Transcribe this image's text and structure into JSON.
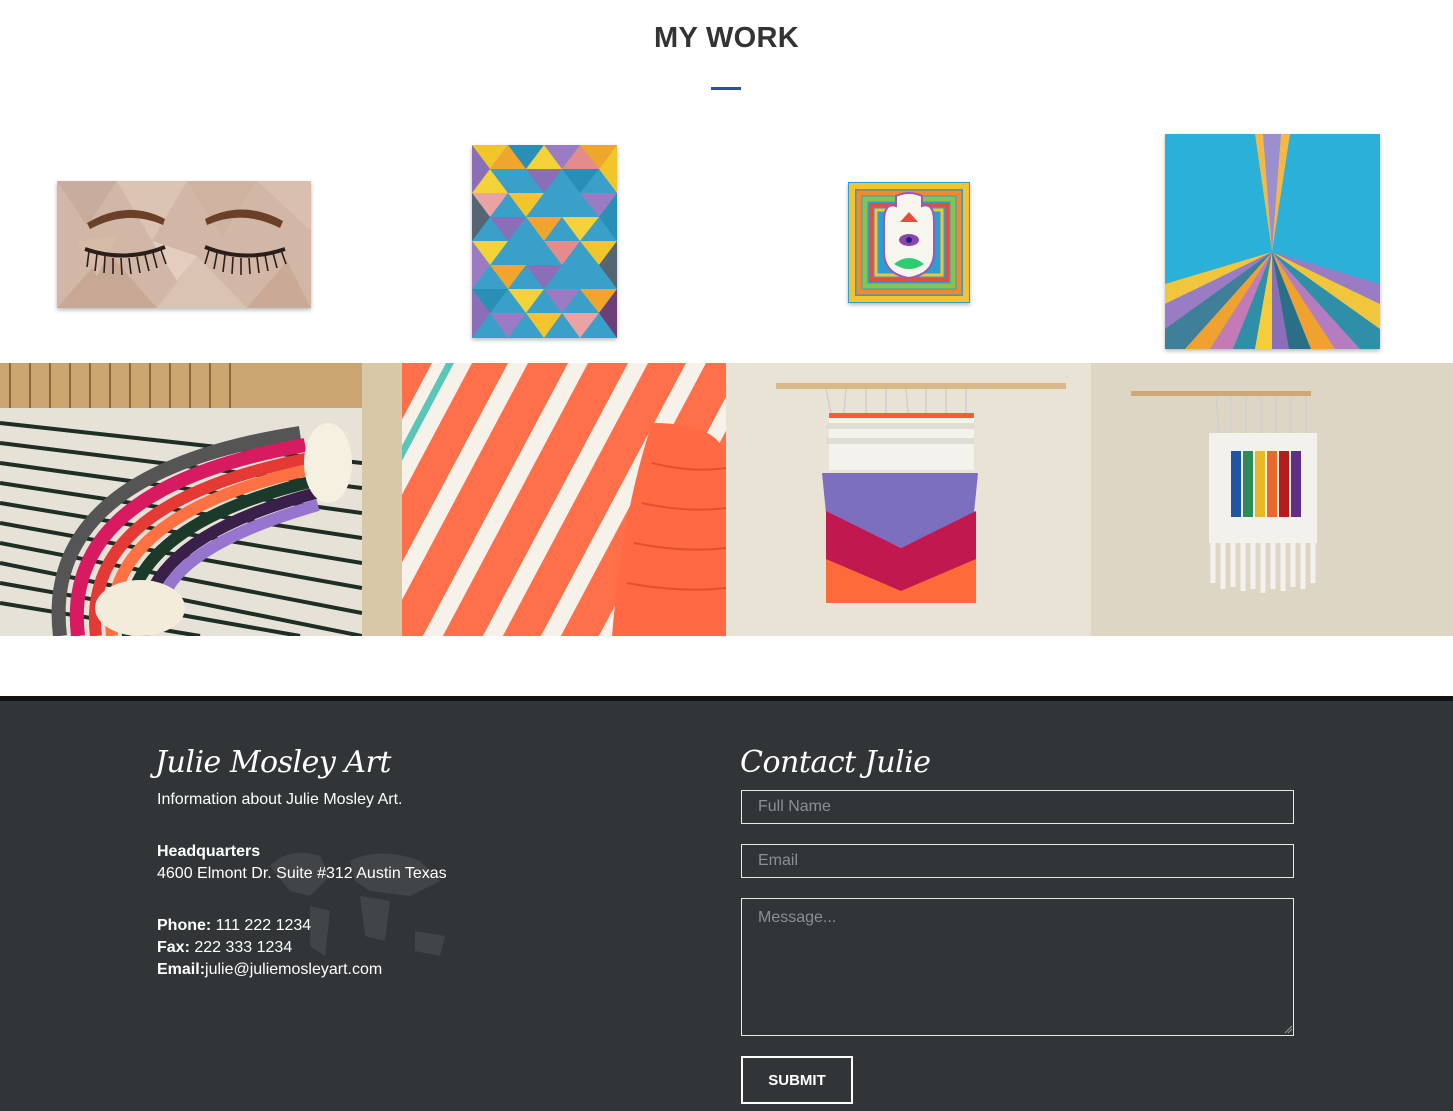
{
  "work": {
    "title": "MY WORK",
    "accent_color": "#2f4fa0",
    "paintings": [
      {
        "name": "closed-eyes-painting"
      },
      {
        "name": "geometric-diamonds-painting"
      },
      {
        "name": "hamsa-painting"
      },
      {
        "name": "rainbow-rays-painting"
      }
    ],
    "weavings": [
      {
        "name": "rainbow-arc-weaving"
      },
      {
        "name": "coral-stripes-weaving"
      },
      {
        "name": "purple-red-fringe-weaving"
      },
      {
        "name": "rainbow-stripes-weaving"
      }
    ]
  },
  "footer": {
    "background": "#313538",
    "brand": "Julie Mosley Art",
    "tagline": "Information about Julie Mosley Art.",
    "hq_label": "Headquarters",
    "hq_address": "4600 Elmont Dr. Suite #312 Austin Texas",
    "phone_label": "Phone:",
    "phone": " 111 222 1234",
    "fax_label": "Fax:",
    "fax": " 222 333 1234",
    "email_label": "Email:",
    "email": "julie@juliemosleyart.com",
    "contact_title": "Contact Julie",
    "form": {
      "name_placeholder": "Full Name",
      "email_placeholder": "Email",
      "message_placeholder": "Message...",
      "submit_label": "SUBMIT"
    }
  }
}
